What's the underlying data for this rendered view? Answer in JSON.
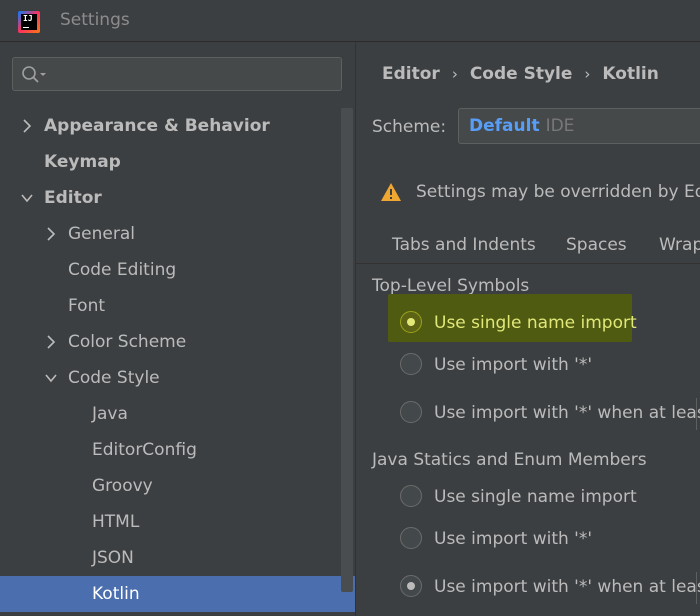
{
  "window": {
    "title": "Settings"
  },
  "sidebar": {
    "search_placeholder": "",
    "items": [
      {
        "label": "Appearance & Behavior",
        "level": 0,
        "bold": true,
        "arrow": "right",
        "selected": false
      },
      {
        "label": "Keymap",
        "level": 0,
        "bold": true,
        "arrow": "none",
        "selected": false
      },
      {
        "label": "Editor",
        "level": 0,
        "bold": true,
        "arrow": "down",
        "selected": false
      },
      {
        "label": "General",
        "level": 1,
        "bold": false,
        "arrow": "right",
        "selected": false
      },
      {
        "label": "Code Editing",
        "level": 1,
        "bold": false,
        "arrow": "none",
        "selected": false
      },
      {
        "label": "Font",
        "level": 1,
        "bold": false,
        "arrow": "none",
        "selected": false
      },
      {
        "label": "Color Scheme",
        "level": 1,
        "bold": false,
        "arrow": "right",
        "selected": false
      },
      {
        "label": "Code Style",
        "level": 1,
        "bold": false,
        "arrow": "down",
        "selected": false
      },
      {
        "label": "Java",
        "level": 2,
        "bold": false,
        "arrow": "none",
        "selected": false
      },
      {
        "label": "EditorConfig",
        "level": 2,
        "bold": false,
        "arrow": "none",
        "selected": false
      },
      {
        "label": "Groovy",
        "level": 2,
        "bold": false,
        "arrow": "none",
        "selected": false
      },
      {
        "label": "HTML",
        "level": 2,
        "bold": false,
        "arrow": "none",
        "selected": false
      },
      {
        "label": "JSON",
        "level": 2,
        "bold": false,
        "arrow": "none",
        "selected": false
      },
      {
        "label": "Kotlin",
        "level": 2,
        "bold": false,
        "arrow": "none",
        "selected": true
      }
    ]
  },
  "main": {
    "breadcrumb": [
      "Editor",
      "Code Style",
      "Kotlin"
    ],
    "scheme": {
      "label": "Scheme:",
      "name": "Default",
      "scope": "IDE"
    },
    "warning": {
      "text": "Settings may be overridden by Edi",
      "icon": "warning-icon"
    },
    "tabs": [
      "Tabs and Indents",
      "Spaces",
      "Wrap"
    ],
    "top_level": {
      "title": "Top-Level Symbols",
      "options": [
        {
          "label": "Use single name import",
          "checked": true,
          "highlighted": true
        },
        {
          "label": "Use import with '*'",
          "checked": false,
          "highlighted": false
        },
        {
          "label": "Use import with '*' when at least",
          "checked": false,
          "highlighted": false
        }
      ]
    },
    "java_statics": {
      "title": "Java Statics and Enum Members",
      "options": [
        {
          "label": "Use single name import",
          "checked": false
        },
        {
          "label": "Use import with '*'",
          "checked": false
        },
        {
          "label": "Use import with '*' when at least",
          "checked": true
        }
      ]
    }
  },
  "colors": {
    "selection": "#4b6eaf",
    "highlight": "#505b12",
    "scheme_name": "#589df6",
    "warning": "#f0a732"
  }
}
